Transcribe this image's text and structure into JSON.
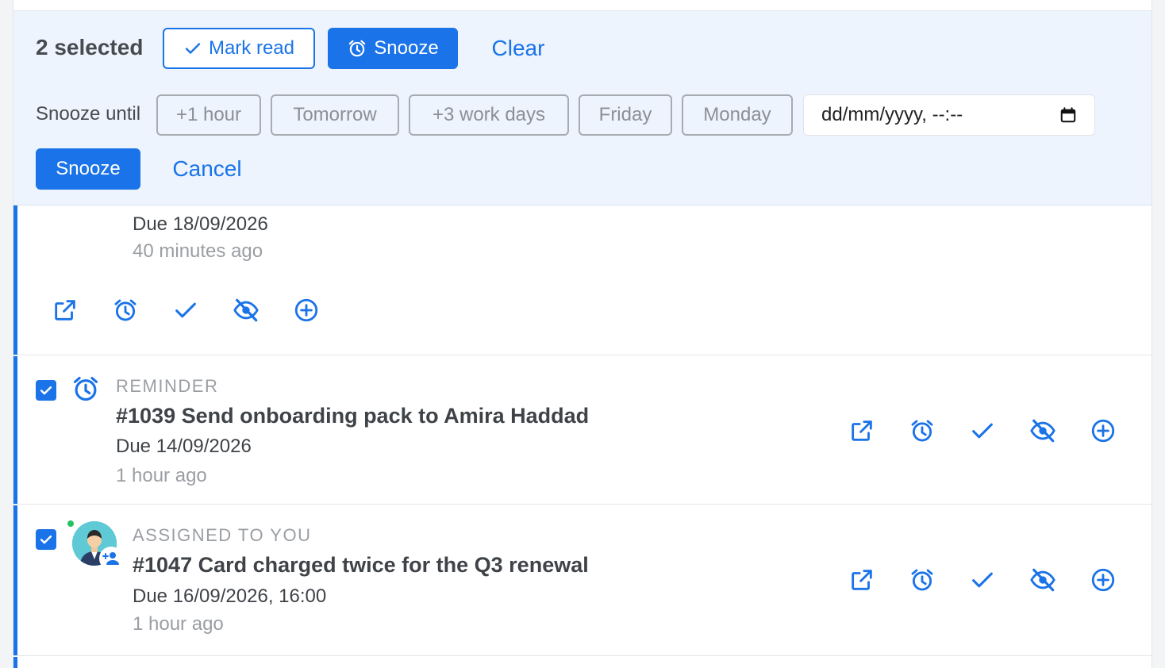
{
  "bulk_bar": {
    "selected_count": "2 selected",
    "mark_read_label": "Mark read",
    "snooze_label": "Snooze",
    "clear_label": "Clear"
  },
  "snooze_panel": {
    "label": "Snooze until",
    "options": [
      "+1 hour",
      "Tomorrow",
      "+3 work days",
      "Friday",
      "Monday"
    ],
    "datetime_placeholder": "dd/mm/yyyy, --:--",
    "submit_label": "Snooze",
    "cancel_label": "Cancel"
  },
  "items": [
    {
      "due": "Due 18/09/2026",
      "time": "40 minutes ago"
    },
    {
      "type": "REMINDER",
      "title": "#1039 Send onboarding pack to Amira Haddad",
      "due": "Due 14/09/2026",
      "time": "1 hour ago",
      "checked": true
    },
    {
      "type": "ASSIGNED TO YOU",
      "title": "#1047 Card charged twice for the Q3 renewal",
      "due": "Due 16/09/2026, 16:00",
      "time": "1 hour ago",
      "checked": true
    }
  ],
  "colors": {
    "accent": "#1a73e8",
    "bulk_bg": "#edf4fd",
    "online": "#22c35e"
  },
  "icons": {
    "actions": [
      "open-external-icon",
      "alarm-clock-icon",
      "checkmark-icon",
      "eye-off-icon",
      "plus-circle-icon"
    ]
  }
}
